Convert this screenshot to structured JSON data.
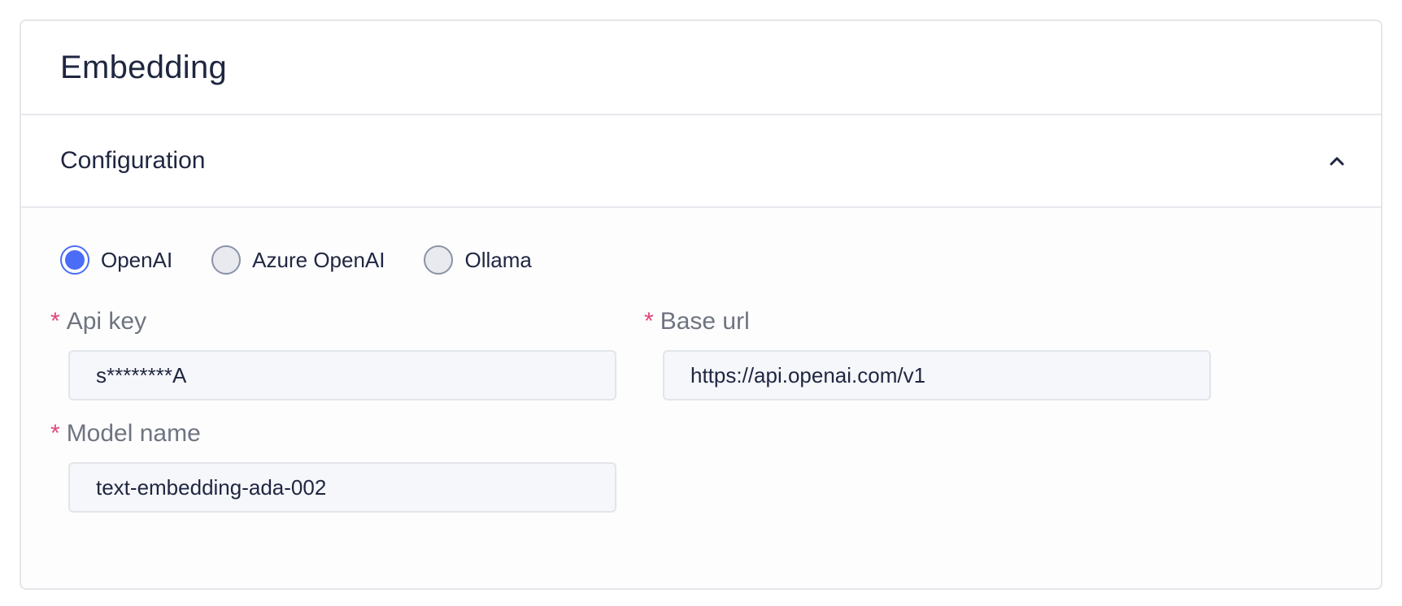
{
  "card": {
    "title": "Embedding"
  },
  "section": {
    "title": "Configuration",
    "expanded": true,
    "toggle_icon": "chevron-up-icon"
  },
  "provider": {
    "options": [
      {
        "label": "OpenAI",
        "selected": true
      },
      {
        "label": "Azure OpenAI",
        "selected": false
      },
      {
        "label": "Ollama",
        "selected": false
      }
    ]
  },
  "fields": {
    "api_key": {
      "label": "Api key",
      "value": "s********A",
      "required": true
    },
    "base_url": {
      "label": "Base url",
      "value": "https://api.openai.com/v1",
      "required": true
    },
    "model_name": {
      "label": "Model name",
      "value": "text-embedding-ada-002",
      "required": true
    }
  },
  "required_marker": "*",
  "colors": {
    "accent": "#4a6cf7",
    "required": "#e0457b",
    "text_primary": "#1f2640",
    "text_label": "#6e7480"
  }
}
